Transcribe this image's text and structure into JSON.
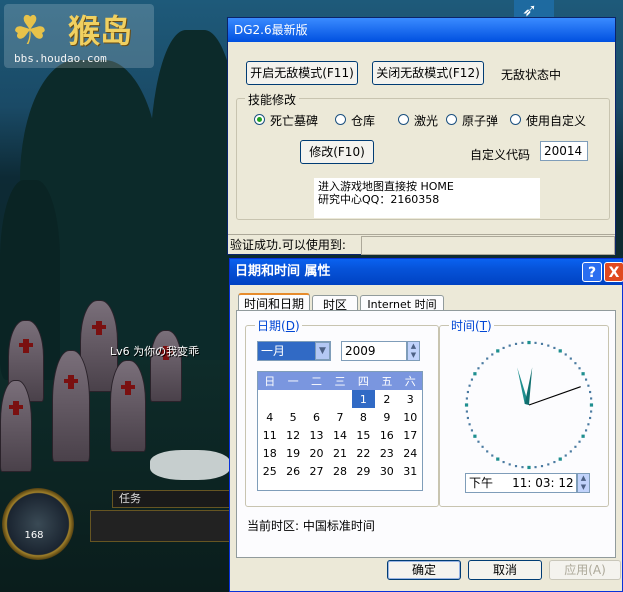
{
  "game": {
    "logo_title": "猴岛",
    "logo_url": "bbs.houdao.com",
    "player_tag": "Lv6 为你の我变乖",
    "task_label": "任务",
    "hud_level": "168"
  },
  "dg_window": {
    "title": "DG2.6最新版",
    "enable_invincible": "开启无敌模式(F11)",
    "disable_invincible": "关闭无敌模式(F12)",
    "invincible_state": "无敌状态中",
    "skill_group_label": "技能修改",
    "skill_options": [
      "死亡墓碑",
      "仓库",
      "激光",
      "原子弹",
      "使用自定义"
    ],
    "selected_option": "死亡墓碑",
    "modify_button": "修改(F10)",
    "custom_code_label": "自定义代码",
    "custom_code_value": "20014",
    "info_line1": "进入游戏地图直接按 HOME",
    "info_line2": "研究中心QQ：2160358",
    "status_text": "验证成功.可以使用到:"
  },
  "datetime_window": {
    "title": "日期和时间 属性",
    "help_icon": "?",
    "close_icon": "X",
    "tabs": [
      "时间和日期",
      "时区",
      "Internet 时间"
    ],
    "date_group_label": "日期",
    "date_group_hotkey": "D",
    "time_group_label": "时间",
    "time_group_hotkey": "T",
    "month_value": "一月",
    "year_value": "2009",
    "weekday_headers": [
      "日",
      "一",
      "二",
      "三",
      "四",
      "五",
      "六"
    ],
    "calendar_rows": [
      [
        "",
        "",
        "",
        "",
        "1",
        "2",
        "3"
      ],
      [
        "4",
        "5",
        "6",
        "7",
        "8",
        "9",
        "10"
      ],
      [
        "11",
        "12",
        "13",
        "14",
        "15",
        "16",
        "17"
      ],
      [
        "18",
        "19",
        "20",
        "21",
        "22",
        "23",
        "24"
      ],
      [
        "25",
        "26",
        "27",
        "28",
        "29",
        "30",
        "31"
      ]
    ],
    "selected_day": "1",
    "time_ampm": "下午",
    "time_value": "11: 03: 12",
    "timezone_text": "当前时区: 中国标准时间",
    "ok_button": "确定",
    "cancel_button": "取消",
    "apply_button": "应用(A)"
  },
  "colors": {
    "xp_titlebar": "#0a5ae8",
    "calendar_header": "#7a96df",
    "selected_day": "#316ac5",
    "clock_hands": "#1f8f8f"
  }
}
